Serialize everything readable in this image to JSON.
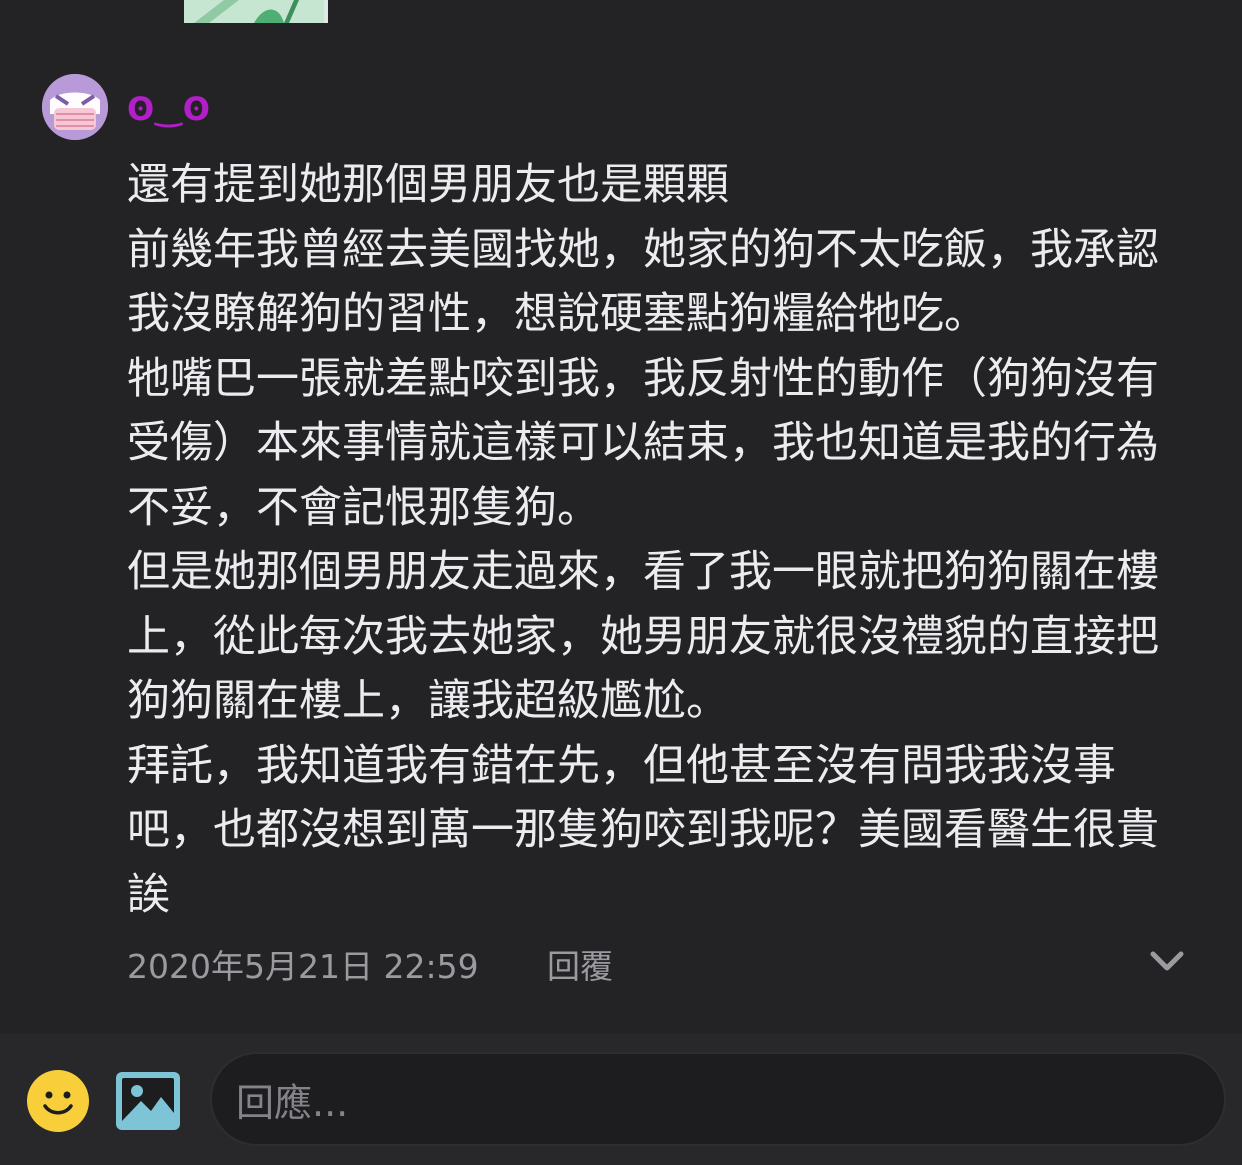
{
  "comment": {
    "username": "ʘ‿ʘ",
    "paragraphs": [
      "還有提到她那個男朋友也是顆顆",
      "前幾年我曾經去美國找她，她家的狗不太吃飯，我承認我沒瞭解狗的習性，想說硬塞點狗糧給牠吃。",
      "牠嘴巴一張就差點咬到我，我反射性的動作（狗狗沒有受傷）本來事情就這樣可以結束，我也知道是我的行為不妥，不會記恨那隻狗。",
      "但是她那個男朋友走過來，看了我一眼就把狗狗關在樓上，從此每次我去她家，她男朋友就很沒禮貌的直接把狗狗關在樓上，讓我超級尷尬。",
      "拜託，我知道我有錯在先，但他甚至沒有問我我沒事吧，也都沒想到萬一那隻狗咬到我呢？美國看醫生很貴誒"
    ],
    "timestamp": "2020年5月21日 22:59",
    "reply_label": "回覆",
    "expand_icon": "chevron-down-icon"
  },
  "composer": {
    "emoji_icon": "smiley-icon",
    "image_icon": "image-icon",
    "placeholder": "回應..."
  },
  "colors": {
    "background": "#232325",
    "username": "#b21ec7",
    "text": "#ecebef",
    "meta": "#9b9aa1",
    "emoji": "#f8cf3b",
    "image_icon": "#7cc4d6"
  }
}
